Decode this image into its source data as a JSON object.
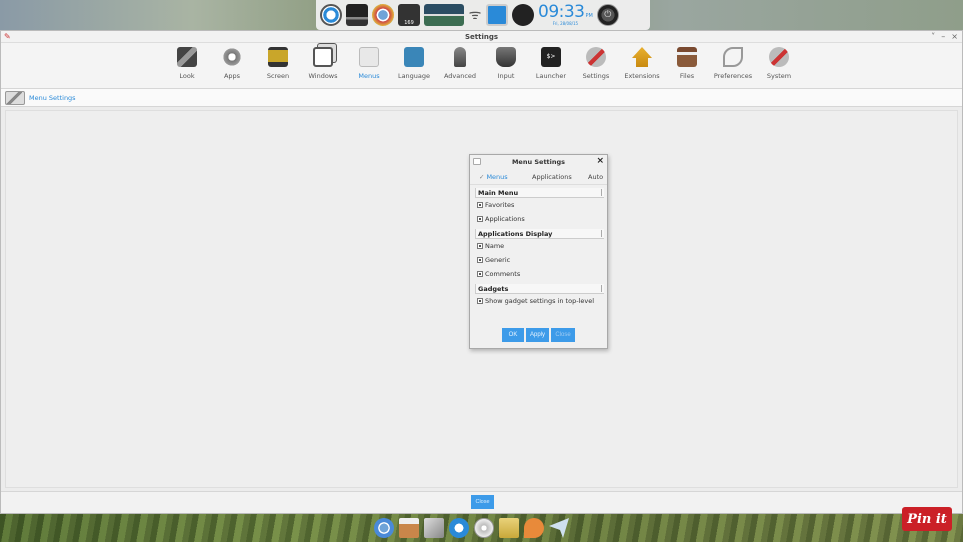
{
  "top_dock": {
    "clock_time": "09:33",
    "clock_suffix": "PM",
    "clock_date": "Fri, 28/08/15",
    "calendar_day": "169"
  },
  "window": {
    "title": "Settings",
    "controls": [
      "˅",
      "–",
      "×"
    ]
  },
  "toolbar": {
    "items": [
      {
        "label": "Look",
        "icon": "look-icon"
      },
      {
        "label": "Apps",
        "icon": "apps-icon"
      },
      {
        "label": "Screen",
        "icon": "screen-icon"
      },
      {
        "label": "Windows",
        "icon": "windows-icon"
      },
      {
        "label": "Menus",
        "icon": "menus-icon",
        "active": true
      },
      {
        "label": "Language",
        "icon": "language-icon"
      },
      {
        "label": "Advanced",
        "icon": "advanced-icon"
      },
      {
        "label": "Input",
        "icon": "input-icon"
      },
      {
        "label": "Launcher",
        "icon": "launcher-icon"
      },
      {
        "label": "Settings",
        "icon": "settings-icon"
      },
      {
        "label": "Extensions",
        "icon": "extensions-icon"
      },
      {
        "label": "Files",
        "icon": "files-icon"
      },
      {
        "label": "Preferences",
        "icon": "preferences-icon"
      },
      {
        "label": "System",
        "icon": "system-icon"
      }
    ],
    "launcher_glyph": "$>"
  },
  "section": {
    "title": "Menu Settings"
  },
  "dialog": {
    "title": "Menu Settings",
    "close_glyph": "×",
    "tabs": [
      {
        "label": "Menus",
        "active": true
      },
      {
        "label": "Applications",
        "active": false
      },
      {
        "label": "Auto",
        "active": false
      }
    ],
    "tab_mark": "✓",
    "groups": [
      {
        "header": "Main Menu",
        "options": [
          {
            "label": "Favorites",
            "checked": true
          },
          {
            "label": "Applications",
            "checked": true
          }
        ]
      },
      {
        "header": "Applications Display",
        "options": [
          {
            "label": "Name",
            "checked": true
          },
          {
            "label": "Generic",
            "checked": true
          },
          {
            "label": "Comments",
            "checked": true
          }
        ]
      },
      {
        "header": "Gadgets",
        "options": [
          {
            "label": "Show gadget settings in top-level",
            "checked": true
          }
        ]
      }
    ],
    "buttons": {
      "ok": "OK",
      "apply": "Apply",
      "close": "Close"
    }
  },
  "bottom_bar": {
    "close_label": "Close"
  },
  "pin": {
    "label": "Pin it"
  },
  "colors": {
    "accent": "#2a8ad8",
    "button": "#3d9be9",
    "pin_red": "#cb2027"
  }
}
